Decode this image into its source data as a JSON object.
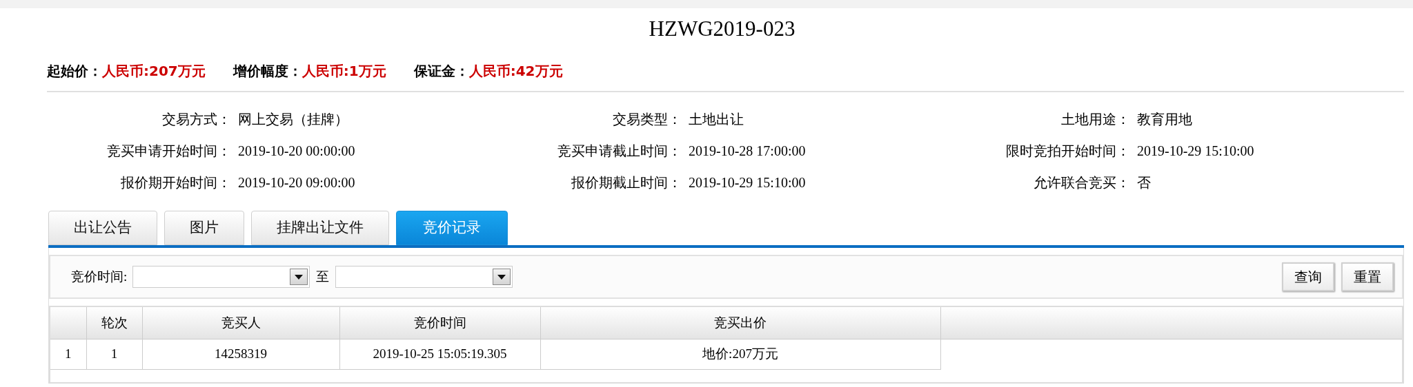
{
  "title": "HZWG2019-023",
  "prices": [
    {
      "label": "起始价：",
      "value": "人民币:207万元"
    },
    {
      "label": "增价幅度：",
      "value": "人民币:1万元"
    },
    {
      "label": "保证金：",
      "value": "人民币:42万元"
    }
  ],
  "info": [
    {
      "label": "交易方式：",
      "value": "网上交易（挂牌）"
    },
    {
      "label": "交易类型：",
      "value": "土地出让"
    },
    {
      "label": "土地用途：",
      "value": "教育用地"
    },
    {
      "label": "竞买申请开始时间：",
      "value": "2019-10-20 00:00:00"
    },
    {
      "label": "竞买申请截止时间：",
      "value": "2019-10-28 17:00:00"
    },
    {
      "label": "限时竞拍开始时间：",
      "value": "2019-10-29 15:10:00"
    },
    {
      "label": "报价期开始时间：",
      "value": "2019-10-20 09:00:00"
    },
    {
      "label": "报价期截止时间：",
      "value": "2019-10-29 15:10:00"
    },
    {
      "label": "允许联合竞买：",
      "value": "否"
    }
  ],
  "tabs": [
    {
      "label": "出让公告",
      "selected": false
    },
    {
      "label": "图片",
      "selected": false
    },
    {
      "label": "挂牌出让文件",
      "selected": false
    },
    {
      "label": "竞价记录",
      "selected": true
    }
  ],
  "filter": {
    "label": "竞价时间:",
    "separator": "至",
    "buttons": [
      "查询",
      "重置"
    ]
  },
  "table": {
    "columns": [
      "轮次",
      "竞买人",
      "竞价时间",
      "竞买出价"
    ],
    "rows": [
      {
        "number": "1",
        "cells": [
          "1",
          "14258319",
          "2019-10-25 15:05:19.305",
          "地价:207万元"
        ]
      }
    ]
  }
}
